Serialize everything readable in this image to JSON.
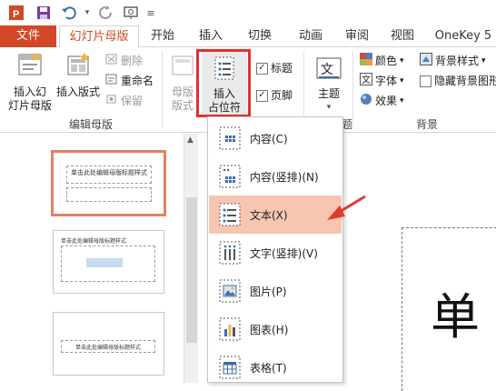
{
  "colors": {
    "file_tab": "#d24726",
    "accent": "#d24726",
    "highlight_box": "#e0322e",
    "hover": "#f7c6b0",
    "arrow": "#e03a2f"
  },
  "qat": {
    "icons": [
      "powerpoint-logo-icon",
      "save-icon",
      "undo-icon",
      "redo-icon",
      "present-icon"
    ]
  },
  "tabs": {
    "file": "文件",
    "slide_master": "幻灯片母版",
    "home": "开始",
    "insert": "插入",
    "transitions": "切换",
    "animations": "动画",
    "review": "审阅",
    "view": "视图",
    "onekey": "OneKey 5"
  },
  "ribbon": {
    "insert_slide_master": "插入幻\n灯片母版",
    "insert_layout": "插入版式",
    "delete": "删除",
    "rename": "重命名",
    "preserve": "保留",
    "edit_master_group": "编辑母版",
    "master_layout": "母版\n版式",
    "insert_placeholder_line1": "插入",
    "insert_placeholder_line2": "占位符",
    "title_check": "标题",
    "footer_check": "页脚",
    "themes": "主题",
    "colors": "颜色",
    "fonts": "字体",
    "effects": "效果",
    "background_styles": "背景样式",
    "hide_background": "隐藏背景图形",
    "background_group": "背景"
  },
  "thumbnails": [
    {
      "text": "单击此处编辑母版标题样式"
    },
    {
      "text": "单击此处编辑母版标题样式"
    },
    {
      "text": "单击此处编辑母版标题样式"
    }
  ],
  "placeholder_menu": {
    "items": [
      {
        "label": "内容(C)",
        "icon": "content-icon"
      },
      {
        "label": "内容(竖排)(N)",
        "icon": "content-vertical-icon"
      },
      {
        "label": "文本(X)",
        "icon": "text-icon"
      },
      {
        "label": "文字(竖排)(V)",
        "icon": "text-vertical-icon"
      },
      {
        "label": "图片(P)",
        "icon": "picture-icon"
      },
      {
        "label": "图表(H)",
        "icon": "chart-icon"
      },
      {
        "label": "表格(T)",
        "icon": "table-icon"
      }
    ],
    "hovered_index": 2
  },
  "slide": {
    "title_char": "单"
  }
}
